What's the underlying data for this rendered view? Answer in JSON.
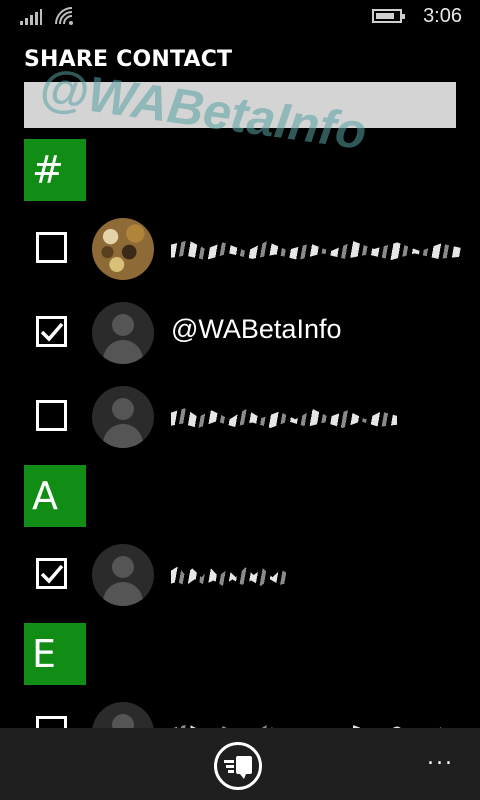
{
  "status_bar": {
    "time": "3:06",
    "battery_level": 0.65
  },
  "page": {
    "title": "SHARE CONTACT"
  },
  "search": {
    "value": "",
    "placeholder": ""
  },
  "watermark": "@WABetaInfo",
  "groups": [
    {
      "letter": "#",
      "contacts": [
        {
          "name": "",
          "redacted": true,
          "checked": false,
          "avatar": "photo"
        },
        {
          "name": "@WABetaInfo",
          "redacted": false,
          "checked": true,
          "avatar": "placeholder"
        },
        {
          "name": "",
          "redacted": true,
          "checked": false,
          "avatar": "placeholder"
        }
      ]
    },
    {
      "letter": "A",
      "contacts": [
        {
          "name": "",
          "redacted": true,
          "checked": true,
          "avatar": "placeholder"
        }
      ]
    },
    {
      "letter": "E",
      "contacts": [
        {
          "name": "",
          "redacted": true,
          "checked": false,
          "avatar": "placeholder"
        }
      ]
    }
  ],
  "app_bar": {
    "share_icon": "share-contact-icon",
    "more": "..."
  },
  "colors": {
    "accent": "#118d16",
    "background": "#000000",
    "app_bar": "#1f1f1f",
    "search_box": "#d4d4d4"
  }
}
